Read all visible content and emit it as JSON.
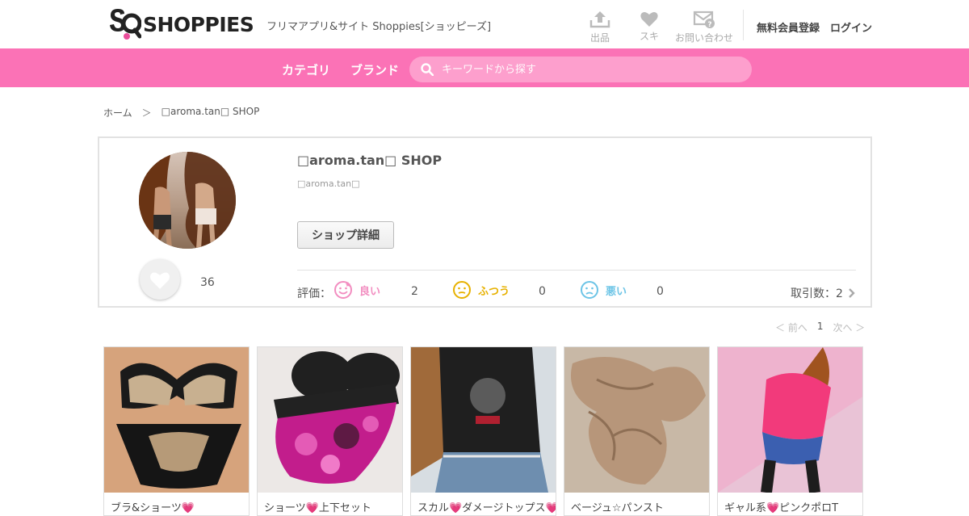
{
  "header": {
    "logo_text": "SHOPPIES",
    "tagline": "フリマアプリ&サイト Shoppies[ショッピーズ]",
    "nav": {
      "sell_label": "出品",
      "like_label": "スキ",
      "contact_label": "お問い合わせ"
    },
    "register_label": "無料会員登録",
    "login_label": "ログイン"
  },
  "pinkbar": {
    "category_label": "カテゴリ",
    "brand_label": "ブランド",
    "search_placeholder": "キーワードから探す",
    "color": "#fb72b6"
  },
  "breadcrumb": {
    "home": "ホーム",
    "separator": "＞",
    "current": "□aroma.tan□ SHOP"
  },
  "shop": {
    "name": "□aroma.tan□ SHOP",
    "user": "□aroma.tan□",
    "detail_button": "ショップ詳細",
    "favorites": "36",
    "rating_label": "評価：",
    "ratings": {
      "good": {
        "label": "良い",
        "count": "2",
        "color": "#f28dc0"
      },
      "normal": {
        "label": "ふつう",
        "count": "0",
        "color": "#e7b100"
      },
      "bad": {
        "label": "悪い",
        "count": "0",
        "color": "#6cc4e6"
      }
    },
    "trades_label": "取引数：2"
  },
  "pager": {
    "prev": "＜ 前へ",
    "current": "1",
    "next": "次へ ＞"
  },
  "items": [
    {
      "title": "ブラ&ショーツ💗"
    },
    {
      "title": "ショーツ💗上下セット"
    },
    {
      "title": "スカル💗ダメージトップス💗"
    },
    {
      "title": "ベージュ☆パンスト"
    },
    {
      "title": "ギャル系💗ピンクポロT"
    }
  ]
}
